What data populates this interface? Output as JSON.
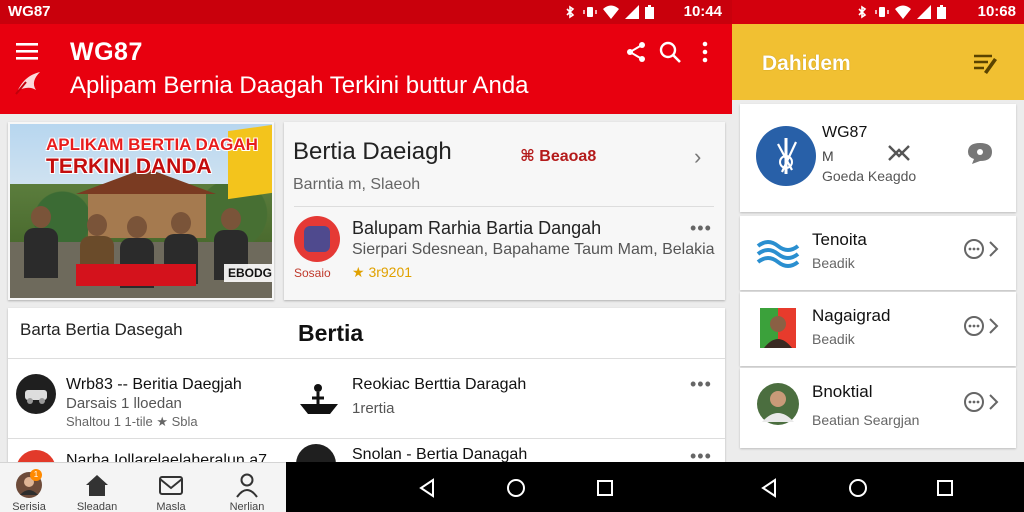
{
  "left": {
    "status": {
      "title": "WG87",
      "time": "10:44"
    },
    "appbar": {
      "brand": "WG87",
      "subtitle": "Aplipam Bernia Daagah Terkini buttur Anda"
    },
    "hero": {
      "headline_line1": "APLIKAM BERTIA DAGAH",
      "headline_line2": "TERKINI DANDA",
      "sign_text": "EBODG"
    },
    "featured": {
      "title": "Bertia Daeiagh",
      "meta": "Barntia m, Slaeoh",
      "chip": "⌘ Beaoa8",
      "app_title": "Balupam Rarhia Bartia Dangah",
      "app_desc": "Sierpari Sdesnean, Bapahame Taum Mam, Belakia",
      "app_tag": "Sosaio",
      "app_rating": "★ 3r9201",
      "more": "•••"
    },
    "section_left_title": "Barta Bertia Dasegah",
    "section_right_title": "Bertia",
    "rows_left": [
      {
        "title": "Wrb83 -- Beritia Daegjah",
        "sub": "Darsais 1 lloedan",
        "meta": "Shaltou 1 1-tile ★ Sbla"
      },
      {
        "title": "Narha Iollarelaelaheralun a7",
        "sub": "",
        "meta": ""
      }
    ],
    "rows_right": [
      {
        "title": "Reokiac Berttia Daragah",
        "sub": "1rertia",
        "more": "•••"
      },
      {
        "title": "Snolan - Bertia Danagah",
        "sub": "",
        "more": "•••"
      }
    ],
    "bottom_nav": [
      {
        "label": "Serisia",
        "icon": "avatar-icon",
        "badge": "1"
      },
      {
        "label": "Sleadan",
        "icon": "home-icon"
      },
      {
        "label": "Masla",
        "icon": "mail-icon"
      },
      {
        "label": "Nerlian",
        "icon": "person-icon"
      }
    ]
  },
  "right": {
    "status": {
      "time": "10:68"
    },
    "appbar": {
      "title": "Dahidem"
    },
    "profile": {
      "name": "WG87",
      "line2": "M",
      "line3": "Goeda Keagdo"
    },
    "items": [
      {
        "title": "Tenoita",
        "sub": "Beadik"
      },
      {
        "title": "Nagaigrad",
        "sub": "Beadik"
      },
      {
        "title": "Bnoktial",
        "sub": "Beatian Seargjan"
      }
    ]
  },
  "colors": {
    "red_bar": "#e8000f",
    "status_red": "#c9000c",
    "yellow_bar": "#f1c032",
    "accent_blue": "#2860a8"
  }
}
